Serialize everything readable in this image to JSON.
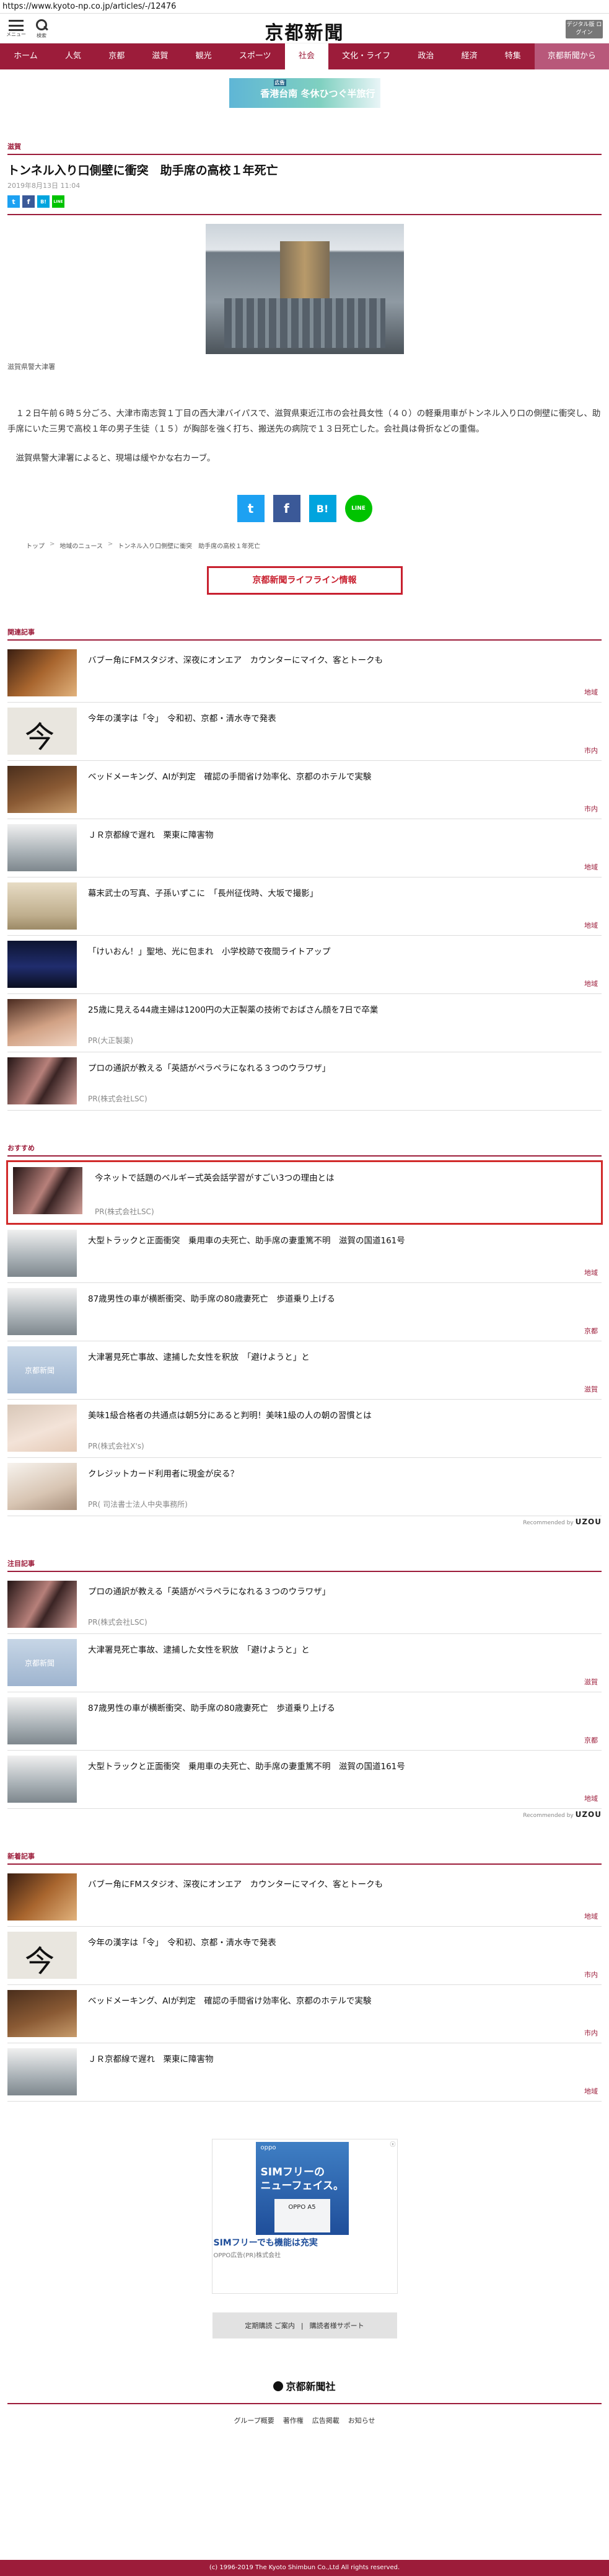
{
  "url": "https://www.kyoto-np.co.jp/articles/-/12476",
  "header": {
    "menu_label": "メニュー",
    "search_label": "検索",
    "logo_text": "京都新聞",
    "digital_label": "デジタル版 ログイン"
  },
  "nav": {
    "items": [
      "ホーム",
      "人気",
      "京都",
      "滋賀",
      "観光",
      "スポーツ",
      "社会",
      "文化・ライフ",
      "政治",
      "経済",
      "特集"
    ],
    "active_index": 6,
    "paper_label": "京都新聞から"
  },
  "top_ad": {
    "label": "広告",
    "text": "香港台南 冬休ひつぐ半旅行"
  },
  "article": {
    "category": "滋賀",
    "title": "トンネル入り口側壁に衝突　助手席の高校１年死亡",
    "date": "2019年8月13日 11:04",
    "photo_caption": "滋賀県警大津署",
    "paragraph1": "１２日午前６時５分ごろ、大津市南志賀１丁目の西大津バイパスで、滋賀県東近江市の会社員女性（４０）の軽乗用車がトンネル入り口の側壁に衝突し、助手席にいた三男で高校１年の男子生徒（１５）が胸部を強く打ち、搬送先の病院で１３日死亡した。会社員は骨折などの重傷。",
    "paragraph2": "滋賀県警大津署によると、現場は緩やかな右カーブ。"
  },
  "share": {
    "twitter": "t",
    "facebook": "f",
    "hatena": "B!",
    "line": "LINE"
  },
  "breadcrumb": [
    "トップ",
    "地域のニュース",
    "トンネル入り口側壁に衝突　助手席の高校１年死亡"
  ],
  "lifeline_label": "京都新聞ライフライン情報",
  "related": {
    "heading": "関連記事",
    "items": [
      {
        "title": "バブー角にFMスタジオ、深夜にオンエア　カウンターにマイク、客とトークも",
        "tag": "地域"
      },
      {
        "title": "今年の漢字は「令」　令和初、京都・清水寺で発表",
        "tag": "市内"
      },
      {
        "title": "ベッドメーキング、AIが判定　確認の手間省け効率化、京都のホテルで実験",
        "tag": "市内"
      },
      {
        "title": "ＪＲ京都線で遅れ　栗東に障害物",
        "tag": "地域"
      },
      {
        "title": "幕末武士の写真、子孫いずこに　「長州征伐時、大坂で撮影」",
        "tag": "地域"
      },
      {
        "title": "「けいおん！」聖地、光に包まれ　小学校跡で夜間ライトアップ",
        "tag": "地域"
      },
      {
        "title": "25歳に見える44歳主婦は1200円の大正製薬の技術でおばさん顔を7日で卒業",
        "pr": "PR(大正製薬)"
      },
      {
        "title": "プロの通訳が教える「英語がペラペラになれる３つのウラワザ」",
        "pr": "PR(株式会社LSC)"
      }
    ]
  },
  "recommend": {
    "heading": "おすすめ",
    "items": [
      {
        "title": "今ネットで話題のベルギー式英会話学習がすごい3つの理由とは",
        "pr": "PR(株式会社LSC)"
      },
      {
        "title": "大型トラックと正面衝突　乗用車の夫死亡、助手席の妻重篤不明　滋賀の国道161号",
        "tag": "地域"
      },
      {
        "title": "87歳男性の車が横断衝突、助手席の80歳妻死亡　歩道乗り上げる",
        "tag": "京都"
      },
      {
        "title": "大津署見死亡事故、逮捕した女性を釈放　「避けようと」と",
        "tag": "滋賀"
      },
      {
        "title": "美味1級合格者の共通点は朝5分にあると判明！美味1級の人の朝の習慣とは",
        "pr": "PR(株式会社X's)"
      },
      {
        "title": "クレジットカード利用者に現金が戻る？",
        "pr": "PR( 司法書士法人中央事務所)"
      }
    ],
    "recommended_by_label": "Recommended by",
    "recommended_by_brand": "UZOU"
  },
  "attention": {
    "heading": "注目記事",
    "items": [
      {
        "title": "プロの通訳が教える「英語がペラペラになれる３つのウラワザ」",
        "pr": "PR(株式会社LSC)"
      },
      {
        "title": "大津署見死亡事故、逮捕した女性を釈放　「避けようと」と",
        "tag": "滋賀"
      },
      {
        "title": "87歳男性の車が横断衝突、助手席の80歳妻死亡　歩道乗り上げる",
        "tag": "京都"
      },
      {
        "title": "大型トラックと正面衝突　乗用車の夫死亡、助手席の妻重篤不明　滋賀の国道161号",
        "tag": "地域"
      }
    ],
    "recommended_by_label": "Recommended by",
    "recommended_by_brand": "UZOU"
  },
  "latest": {
    "heading": "新着記事",
    "items": [
      {
        "title": "バブー角にFMスタジオ、深夜にオンエア　カウンターにマイク、客とトークも",
        "tag": "地域"
      },
      {
        "title": "今年の漢字は「令」　令和初、京都・清水寺で発表",
        "tag": "市内"
      },
      {
        "title": "ベッドメーキング、AIが判定　確認の手間省け効率化、京都のホテルで実験",
        "tag": "市内"
      },
      {
        "title": "ＪＲ京都線で遅れ　栗東に障害物",
        "tag": "地域"
      }
    ]
  },
  "ad": {
    "brand": "oppo",
    "line1": "SIMフリーの",
    "line2": "ニューフェイス。",
    "phone_label": "OPPO A5",
    "cta": "SIMフリーでも機能は充実",
    "advertiser": "OPPO広告(PR)株式会社"
  },
  "support": {
    "left": "定期購読 ご案内",
    "right": "購読者様サポート"
  },
  "footer": {
    "corp_name": "京都新聞社",
    "links": [
      "グループ概要",
      "著作権",
      "広告掲載",
      "お知らせ"
    ],
    "copyright": "(c) 1996-2019 The Kyoto Shimbun Co.,Ltd All rights reserved."
  }
}
